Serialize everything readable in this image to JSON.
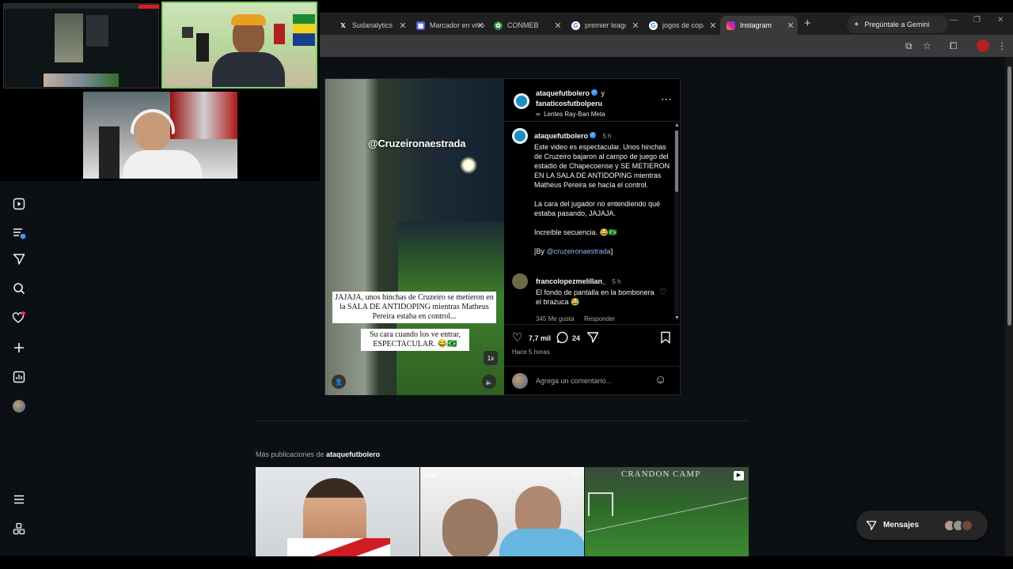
{
  "browser": {
    "tabs": [
      {
        "label": "Sudanalytics",
        "favicon": "x-icon",
        "active": false
      },
      {
        "label": "Marcador en vivo",
        "favicon": "scoreboard-icon",
        "active": false
      },
      {
        "label": "CONMEBOL Copa",
        "favicon": "conmebol-icon",
        "active": false
      },
      {
        "label": "premier league",
        "favicon": "google-icon",
        "active": false
      },
      {
        "label": "jogos de copa",
        "favicon": "google-icon",
        "active": false
      },
      {
        "label": "Instagram",
        "favicon": "instagram-icon",
        "active": true
      }
    ],
    "gemini_label": "Pregúntale a Gemini",
    "accent": "#8ab4f8"
  },
  "sidebar": {
    "items": [
      "reels-icon",
      "feed-icon",
      "messages-icon",
      "search-icon",
      "notifications-icon",
      "create-icon",
      "dashboard-icon",
      "profile-avatar",
      "menu-icon",
      "apps-icon"
    ]
  },
  "post": {
    "header": {
      "author": "ataquefutbolero",
      "conjunction": "y",
      "coauthor": "fanaticosfutbolperu",
      "subtitle": "Lentes Ray-Ban Meta"
    },
    "media": {
      "watermark": "@Cruzeironaestrada",
      "caption_1": "JAJAJA, unos hinchas de Cruzeiro se metieron en la SALA DE ANTIDOPING mientras Matheus Pereira estaba en control...",
      "caption_2": "Su cara cuando los ve entrar, ESPECTACULAR. 😂🇧🇷",
      "speed": "1x"
    },
    "caption": {
      "author": "ataquefutbolero",
      "time": "5 h",
      "paragraph_1": "Este video es espectacular. Unos hinchas de Cruzeiro bajaron al campo de juego del estadio de Chapecoense y SE METIERON EN LA SALA DE ANTIDOPING mientras Matheus Pereira se hacía el control.",
      "paragraph_2": "La cara del jugador no entendiendo qué estaba pasando, JAJAJA.",
      "paragraph_3": "Increíble secuencia. 😂🇧🇷",
      "credit_prefix": "[By ",
      "credit_link": "@cruzeironaestrada",
      "credit_suffix": "]"
    },
    "comment": {
      "author": "francolopezmelillan_",
      "time": "5 h",
      "text": "El fondo de pantalla en la bombonera el brazuca 😂",
      "likes": "345 Me gusta",
      "reply": "Responder"
    },
    "stats": {
      "likes": "7,7 mil",
      "comments": "24",
      "posted": "Hace 5 horas"
    },
    "comment_placeholder": "Agrega un comentario..."
  },
  "more_posts": {
    "prefix": "Más publicaciones de",
    "author": "ataquefutbolero",
    "thumb2_brand": "FDF",
    "thumb3_brand": "CRANDON CAMP"
  },
  "messages_label": "Mensajes"
}
